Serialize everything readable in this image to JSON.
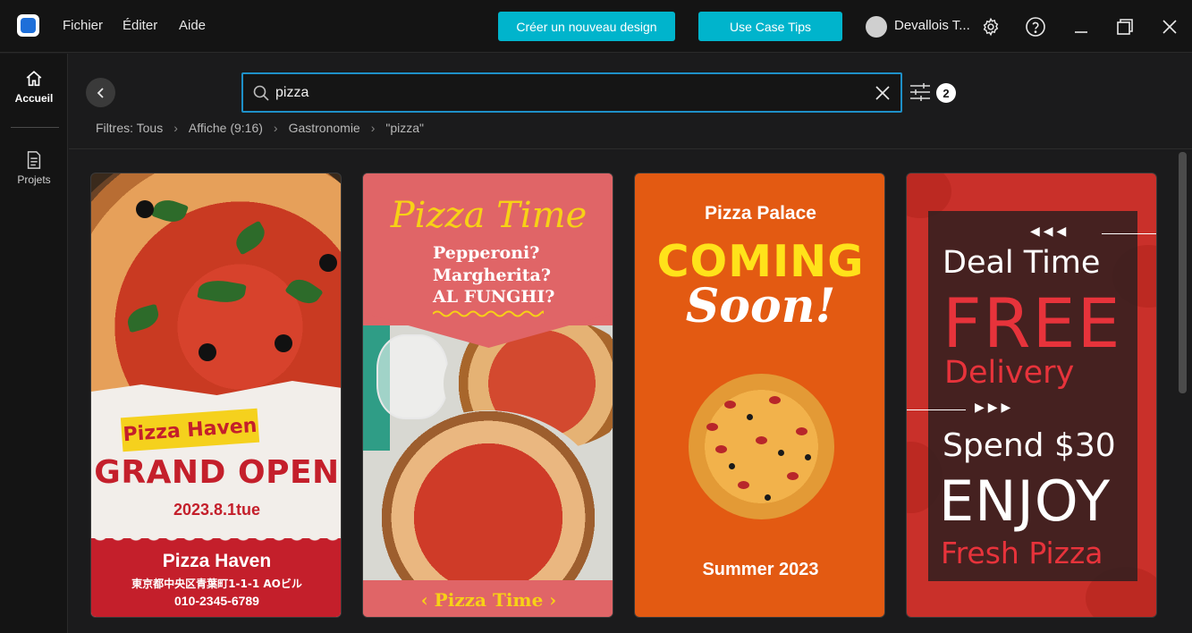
{
  "menu": {
    "file": "Fichier",
    "edit": "Éditer",
    "help": "Aide"
  },
  "toolbar": {
    "new_design": "Créer un nouveau design",
    "tips": "Use Case Tips"
  },
  "user": {
    "name": "Devallois T..."
  },
  "sidebar": {
    "home": "Accueil",
    "projects": "Projets"
  },
  "search": {
    "value": "pizza"
  },
  "filter": {
    "count": "2"
  },
  "breadcrumb": [
    "Filtres: Tous",
    "Affiche (9:16)",
    "Gastronomie",
    "\"pizza\""
  ],
  "cards": [
    {
      "tag": "Pizza Haven",
      "headline": "GRAND OPEN",
      "date": "2023.8.1tue",
      "name": "Pizza Haven",
      "address": "東京都中央区青葉町1-1-1 AOビル",
      "phone": "010-2345-6789"
    },
    {
      "title": "Pizza Time",
      "line1": "Pepperoni?",
      "line2": "Margherita?",
      "line3": "AL FUNGHI?",
      "footer": "‹  Pizza Time  ›"
    },
    {
      "brand": "Pizza Palace",
      "headline": "COMING",
      "subhead": "Soon!",
      "footer": "Summer 2023"
    },
    {
      "arrows_top": "◀◀◀",
      "deal": "Deal Time",
      "free": "FREE",
      "delivery": "Delivery",
      "arrows_mid": "▶▶▶",
      "spend": "Spend $30",
      "enjoy": "ENJOY",
      "fresh": "Fresh Pizza"
    }
  ],
  "colors": {
    "accent": "#00b4cc",
    "search_border": "#1e90c8",
    "brand_red": "#c41f2b",
    "yellow": "#f7d116"
  }
}
